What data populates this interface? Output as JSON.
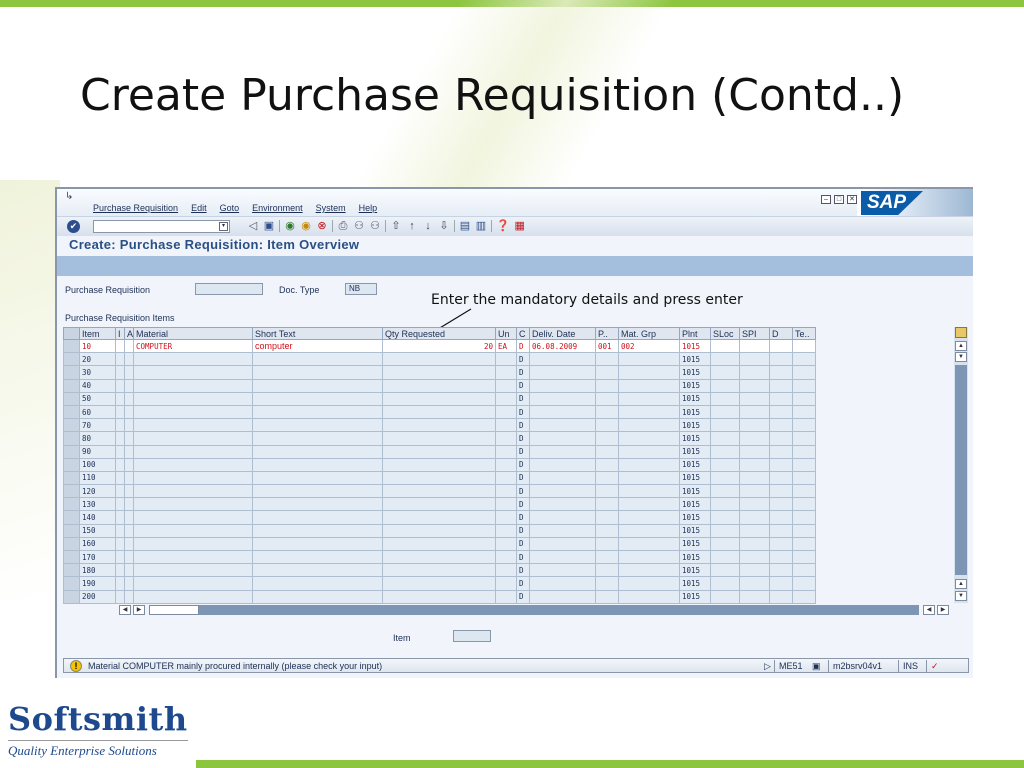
{
  "slide": {
    "title": "Create Purchase Requisition (Contd..)",
    "callout": "Enter the mandatory details and press enter",
    "logo_name": "Softsmith",
    "logo_tagline": "Quality Enterprise Solutions"
  },
  "sap": {
    "menu": [
      "Purchase Requisition",
      "Edit",
      "Goto",
      "Environment",
      "System",
      "Help"
    ],
    "logo": "SAP",
    "screen_title": "Create: Purchase Requisition: Item Overview",
    "pr_label": "Purchase Requisition",
    "pr_value": "",
    "doctype_label": "Doc. Type",
    "doctype_value": "NB",
    "items_label": "Purchase Requisition Items",
    "columns": [
      "Item",
      "I",
      "A",
      "Material",
      "Short Text",
      "Qty Requested",
      "Un",
      "C",
      "Deliv. Date",
      "P..",
      "Mat. Grp",
      "Plnt",
      "SLoc",
      "SPI",
      "D",
      "Te.."
    ],
    "rows": [
      {
        "item": "10",
        "material": "COMPUTER",
        "short_text": "computer",
        "qty": "20",
        "un": "EA",
        "c": "D",
        "date": "06.08.2009",
        "p": "001",
        "matgrp": "002",
        "plnt": "1015"
      },
      {
        "item": "20",
        "c": "D",
        "plnt": "1015"
      },
      {
        "item": "30",
        "c": "D",
        "plnt": "1015"
      },
      {
        "item": "40",
        "c": "D",
        "plnt": "1015"
      },
      {
        "item": "50",
        "c": "D",
        "plnt": "1015"
      },
      {
        "item": "60",
        "c": "D",
        "plnt": "1015"
      },
      {
        "item": "70",
        "c": "D",
        "plnt": "1015"
      },
      {
        "item": "80",
        "c": "D",
        "plnt": "1015"
      },
      {
        "item": "90",
        "c": "D",
        "plnt": "1015"
      },
      {
        "item": "100",
        "c": "D",
        "plnt": "1015"
      },
      {
        "item": "110",
        "c": "D",
        "plnt": "1015"
      },
      {
        "item": "120",
        "c": "D",
        "plnt": "1015"
      },
      {
        "item": "130",
        "c": "D",
        "plnt": "1015"
      },
      {
        "item": "140",
        "c": "D",
        "plnt": "1015"
      },
      {
        "item": "150",
        "c": "D",
        "plnt": "1015"
      },
      {
        "item": "160",
        "c": "D",
        "plnt": "1015"
      },
      {
        "item": "170",
        "c": "D",
        "plnt": "1015"
      },
      {
        "item": "180",
        "c": "D",
        "plnt": "1015"
      },
      {
        "item": "190",
        "c": "D",
        "plnt": "1015"
      },
      {
        "item": "200",
        "c": "D",
        "plnt": "1015"
      }
    ],
    "item_label": "Item",
    "item_value": "",
    "status": {
      "message": "Material COMPUTER mainly procured internally (please check your input)",
      "transaction": "ME51",
      "server": "m2bsrv04v1",
      "mode": "INS"
    }
  },
  "colors": {
    "accent_green": "#8cc63f",
    "sap_blue": "#0a5ca8",
    "error_red": "#d0101a"
  }
}
